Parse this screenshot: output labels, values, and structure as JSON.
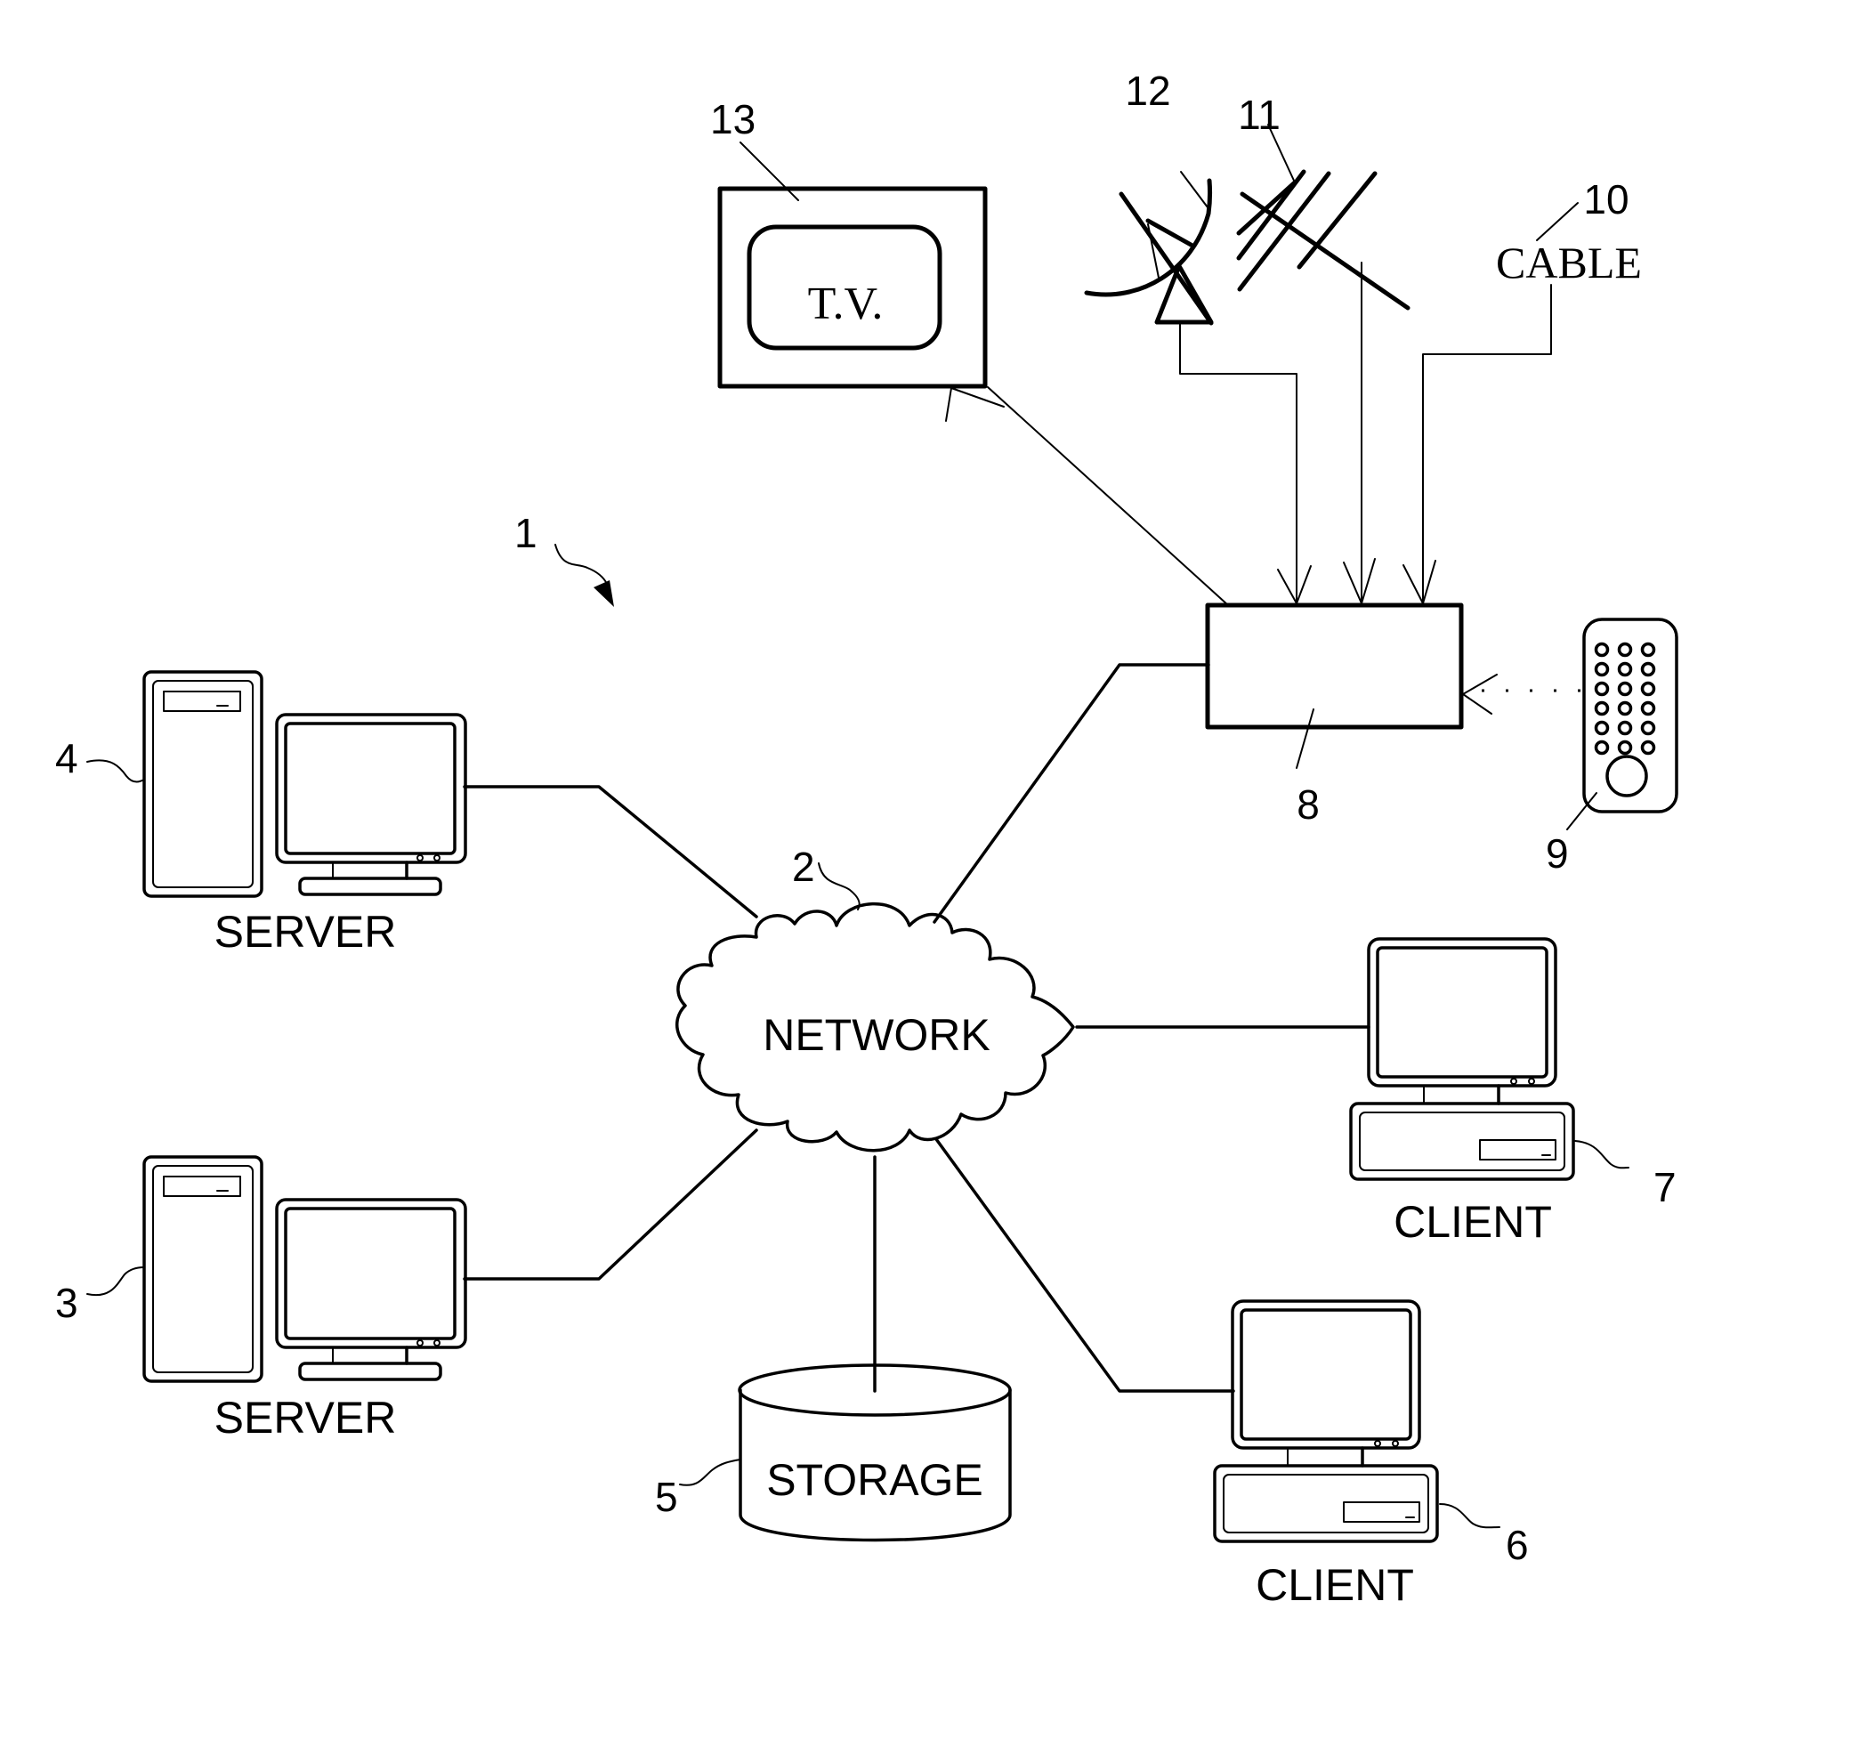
{
  "figure": {
    "system_ref": "1",
    "network": {
      "ref": "2",
      "label": "NETWORK"
    },
    "servers": [
      {
        "ref": "4",
        "label": "SERVER"
      },
      {
        "ref": "3",
        "label": "SERVER"
      }
    ],
    "storage": {
      "ref": "5",
      "label": "STORAGE"
    },
    "clients": [
      {
        "ref": "7",
        "label": "CLIENT"
      },
      {
        "ref": "6",
        "label": "CLIENT"
      }
    ],
    "receiver": {
      "ref": "8"
    },
    "remote": {
      "ref": "9"
    },
    "cable": {
      "ref": "10",
      "label": "CABLE"
    },
    "antenna": {
      "ref": "11"
    },
    "satellite_dish": {
      "ref": "12"
    },
    "tv": {
      "ref": "13",
      "label": "T.V."
    }
  }
}
